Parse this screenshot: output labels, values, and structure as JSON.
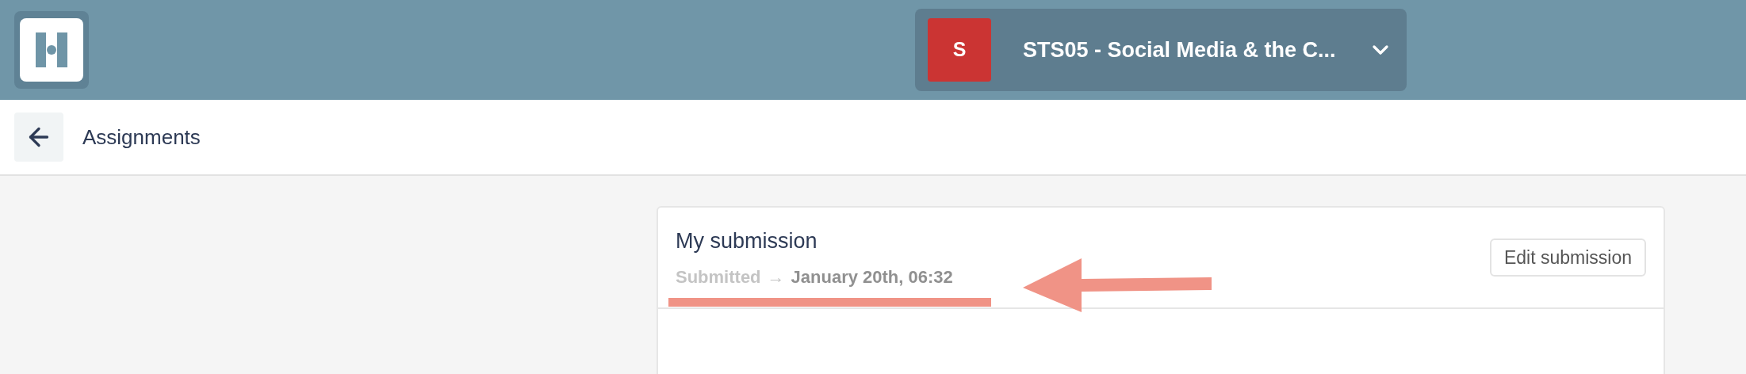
{
  "course_selector": {
    "badge": "S",
    "title": "STS05 - Social Media & the C..."
  },
  "subheader": {
    "title": "Assignments"
  },
  "submission": {
    "title": "My submission",
    "status": "Submitted",
    "arrow": "→",
    "date": "January 20th, 06:32",
    "edit_button": "Edit submission"
  }
}
